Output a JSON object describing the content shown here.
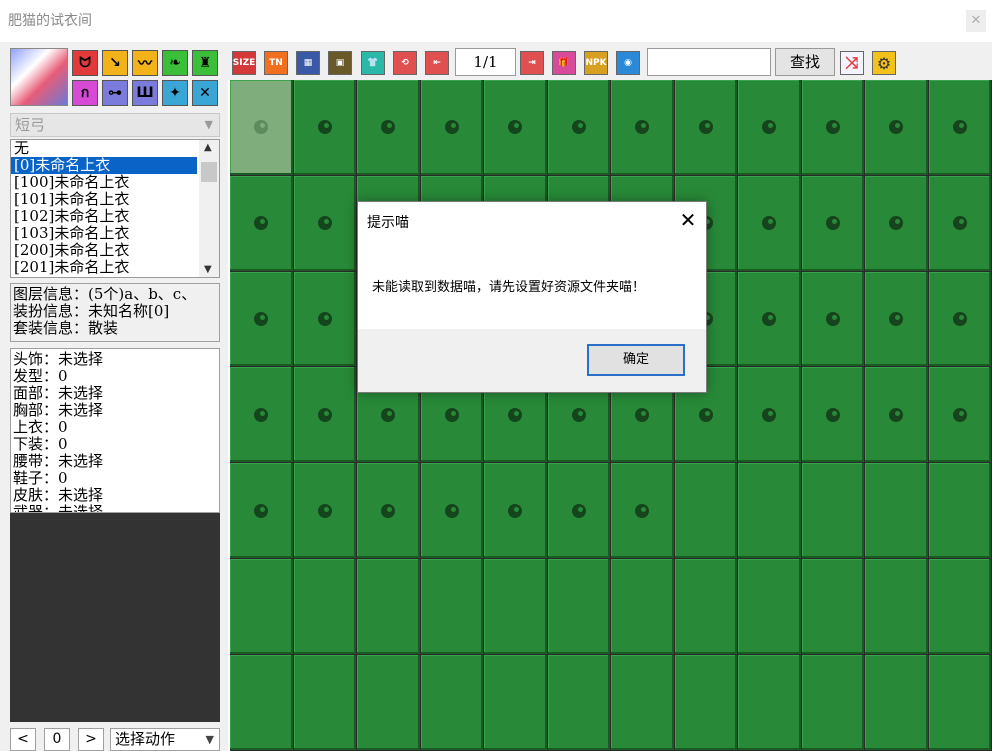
{
  "window": {
    "title": "肥猫的试衣间",
    "close_glyph": "✕"
  },
  "left": {
    "category_select": "短弓",
    "item_list": [
      "无",
      "[0]未命名上衣",
      "[100]未命名上衣",
      "[101]未命名上衣",
      "[102]未命名上衣",
      "[103]未命名上衣",
      "[200]未命名上衣",
      "[201]未命名上衣"
    ],
    "selected_index": 1,
    "layer_info": [
      "图层信息：(5个)a、b、c、",
      "装扮信息：未知名称[0]",
      "套装信息：散装"
    ],
    "parts": [
      "头饰：未选择",
      "发型：0",
      "面部：未选择",
      "胸部：未选择",
      "上衣：0",
      "下装：0",
      "腰带：未选择",
      "鞋子：0",
      "皮肤：未选择",
      "武器：未选择"
    ],
    "nav_prev": "<",
    "frame": "0",
    "nav_next": ">",
    "action_select": "选择动作"
  },
  "category_icons": [
    "helmet-icon",
    "hair-icon",
    "face-icon",
    "wings-icon",
    "chest-icon",
    "pants-icon",
    "belt-icon",
    "shoes-icon",
    "cloak-icon",
    "weapon-icon"
  ],
  "category_glyphs": [
    "ᗢ",
    "↘",
    "〰",
    "❧",
    "♜",
    "ก",
    "⊶",
    "Ш",
    "✦",
    "✕"
  ],
  "category_colors": [
    "#e23a3a",
    "#f2b21a",
    "#f2b21a",
    "#3bbf3b",
    "#3bbf3b",
    "#d64ad6",
    "#7b7bdc",
    "#7b7bdc",
    "#3aa6d6",
    "#3aa6d6"
  ],
  "toolbar": {
    "page": "1/1",
    "search_value": "",
    "find_label": "查找",
    "tools": [
      {
        "name": "size-icon",
        "glyph": "SIZE",
        "color": "#d43838"
      },
      {
        "name": "tn-icon",
        "glyph": "TN",
        "color": "#f07020"
      },
      {
        "name": "grid-view-icon",
        "glyph": "▦",
        "color": "#3a5aa8"
      },
      {
        "name": "frame-icon",
        "glyph": "▣",
        "color": "#6a5a2a"
      },
      {
        "name": "shirt-icon",
        "glyph": "👕",
        "color": "#2ab8a8"
      },
      {
        "name": "refresh-icon",
        "glyph": "⟲",
        "color": "#e05050"
      },
      {
        "name": "import-icon",
        "glyph": "⇤",
        "color": "#e05050"
      }
    ],
    "tools_right": [
      {
        "name": "export-icon",
        "glyph": "⇥",
        "color": "#e05050"
      },
      {
        "name": "gift-icon",
        "glyph": "🎁",
        "color": "#d84a9a"
      },
      {
        "name": "npk-icon",
        "glyph": "NPK",
        "color": "#d8a020"
      },
      {
        "name": "globe-icon",
        "glyph": "◉",
        "color": "#2a8ad8"
      }
    ],
    "shuffle_icon": "shuffle-icon",
    "settings_icon": "gear-icon"
  },
  "grid": {
    "cols": 12,
    "rows": 7,
    "icon_cells": 55,
    "highlight": 0
  },
  "dialog": {
    "title": "提示喵",
    "message": "未能读取到数据喵，请先设置好资源文件夹喵！",
    "ok": "确定",
    "close_glyph": "✕"
  }
}
